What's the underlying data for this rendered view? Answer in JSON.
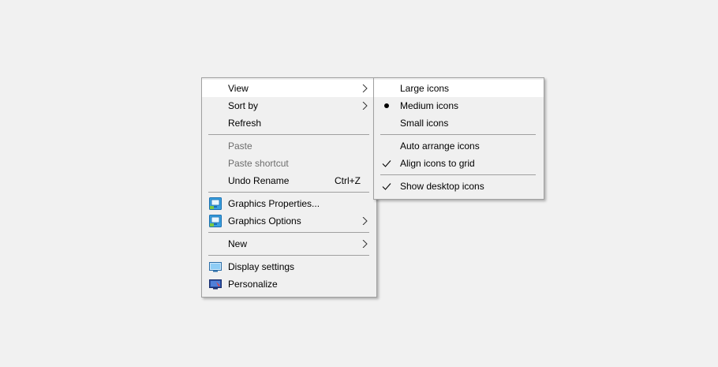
{
  "context_menu": {
    "items": [
      {
        "label": "View"
      },
      {
        "label": "Sort by"
      },
      {
        "label": "Refresh"
      },
      {
        "label": "Paste"
      },
      {
        "label": "Paste shortcut"
      },
      {
        "label": "Undo Rename",
        "shortcut": "Ctrl+Z"
      },
      {
        "label": "Graphics Properties...",
        "icon": "intel-graphics-icon"
      },
      {
        "label": "Graphics Options",
        "icon": "intel-graphics-icon"
      },
      {
        "label": "New"
      },
      {
        "label": "Display settings",
        "icon": "display-icon"
      },
      {
        "label": "Personalize",
        "icon": "personalize-icon"
      }
    ]
  },
  "view_submenu": {
    "items": [
      {
        "label": "Large icons"
      },
      {
        "label": "Medium icons",
        "state": "selected-bullet"
      },
      {
        "label": "Small icons"
      },
      {
        "label": "Auto arrange icons"
      },
      {
        "label": "Align icons to grid",
        "state": "checked"
      },
      {
        "label": "Show desktop icons",
        "state": "checked"
      }
    ]
  },
  "colors": {
    "menu_background": "#f0f0f0",
    "hover_background": "#ffffff",
    "border": "#a0a0a0",
    "disabled_text": "#6d6d6d",
    "desktop_background": "#f1f1f1"
  }
}
